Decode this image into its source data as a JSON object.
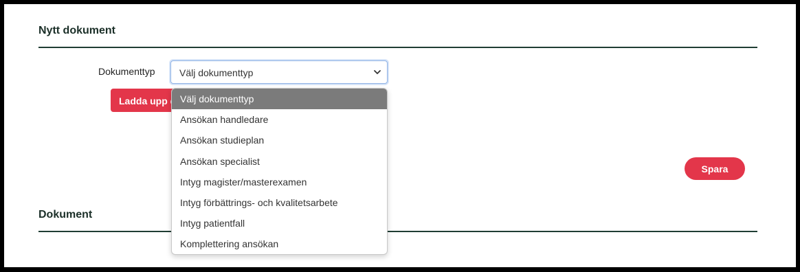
{
  "new_document": {
    "title": "Nytt dokument",
    "document_type_label": "Dokumenttyp",
    "select": {
      "value": "Välj dokumenttyp",
      "options": [
        "Välj dokumenttyp",
        "Ansökan handledare",
        "Ansökan studieplan",
        "Ansökan specialist",
        "Intyg magister/masterexamen",
        "Intyg förbättrings- och kvalitetsarbete",
        "Intyg patientfall",
        "Komplettering ansökan"
      ]
    },
    "upload_button_label": "Ladda upp dokument",
    "save_button_label": "Spara"
  },
  "documents": {
    "title": "Dokument"
  },
  "colors": {
    "accent_red": "#e3364a",
    "heading_rule": "#1f3d33",
    "selected_option_bg": "#7b7b7b"
  },
  "icons": {
    "select_chevron": "chevron-down-icon"
  }
}
